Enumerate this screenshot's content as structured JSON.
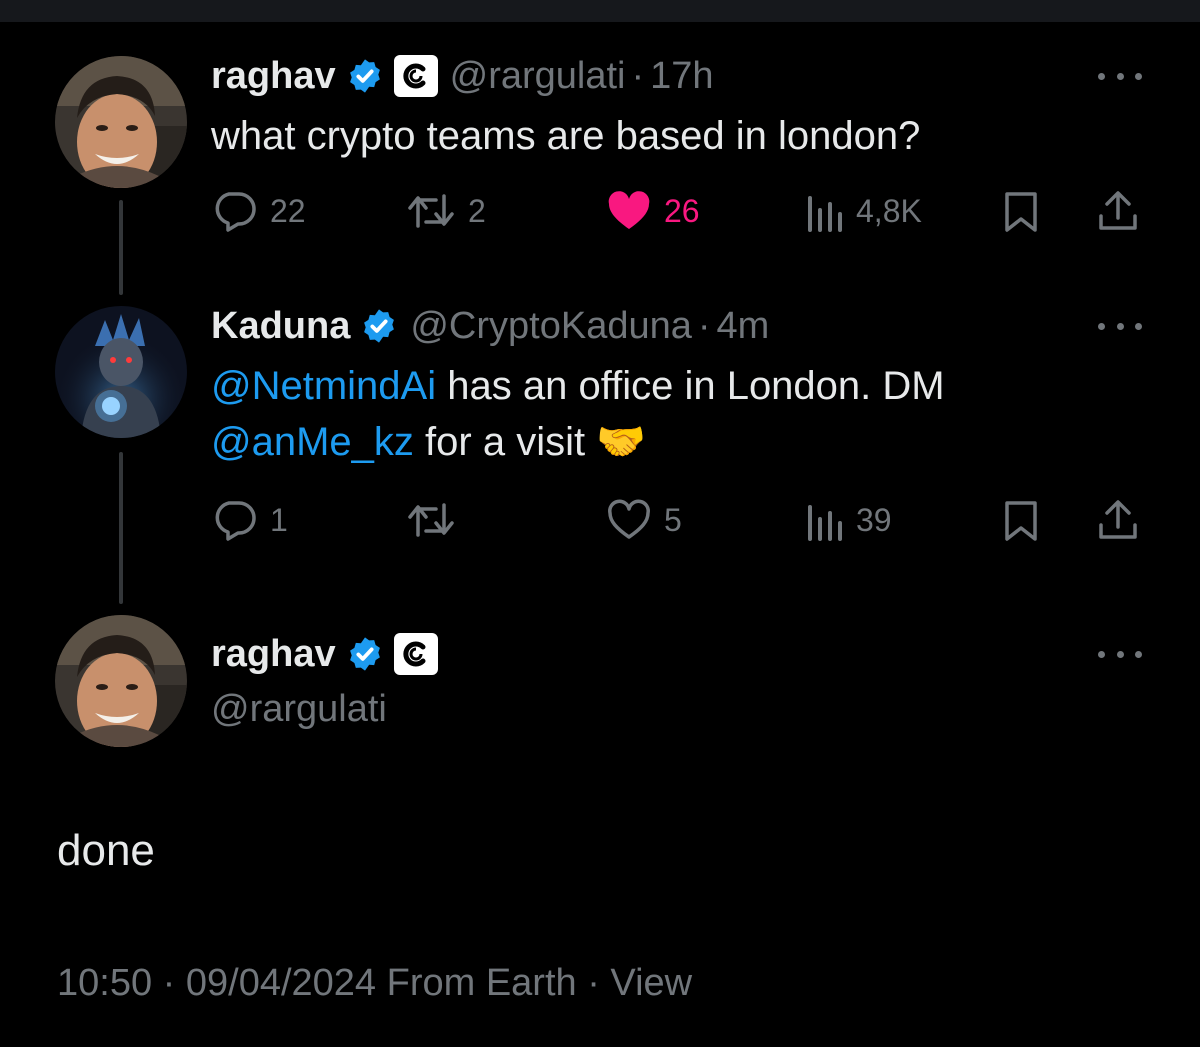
{
  "tweets": [
    {
      "name": "raghav",
      "handle": "@rargulati",
      "separator": "·",
      "time": "17h",
      "text": "what crypto teams are based in london?",
      "replies": "22",
      "retweets": "2",
      "likes": "26",
      "views": "4,8K",
      "liked": true
    },
    {
      "name": "Kaduna",
      "handle": "@CryptoKaduna",
      "separator": "·",
      "time": "4m",
      "line1_mention": "@NetmindAi",
      "line1_text": " has an office in London. DM",
      "line2_mention": "@anMe_kz",
      "line2_text": " for a visit 🤝",
      "replies": "1",
      "retweets": "",
      "likes": "5",
      "views": "39",
      "liked": false
    }
  ],
  "main_tweet": {
    "name": "raghav",
    "handle": "@rargulati",
    "text": "done",
    "meta": "10:50 · 09/04/2024 From Earth · View"
  },
  "colors": {
    "background": "#000000",
    "text": "#e7e9ea",
    "secondary": "#71767b",
    "accent": "#1d9bf0",
    "like": "#f91880"
  },
  "icons": {
    "verified": "verified-badge-icon",
    "affiliate": "affiliate-c-icon",
    "reply": "reply-icon",
    "retweet": "retweet-icon",
    "like": "heart-icon",
    "views": "views-icon",
    "bookmark": "bookmark-icon",
    "share": "share-icon",
    "more": "more-icon"
  }
}
